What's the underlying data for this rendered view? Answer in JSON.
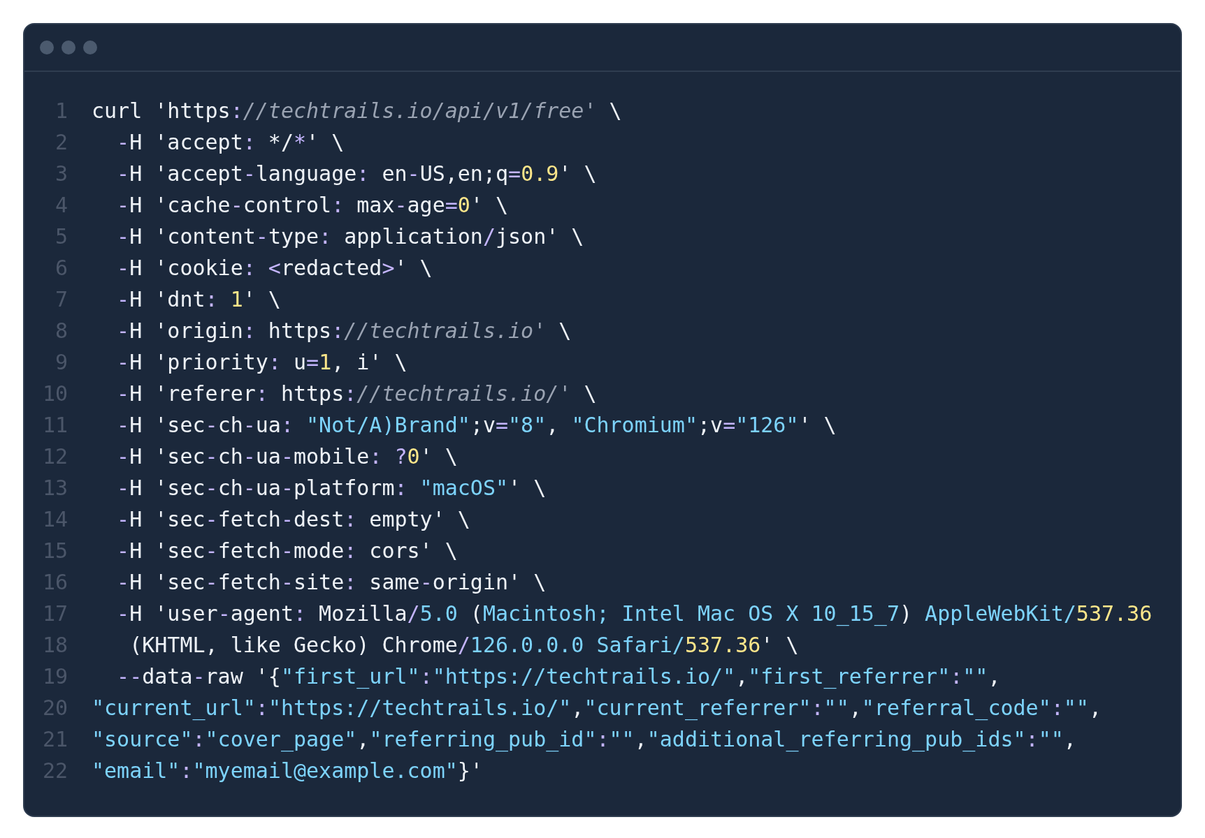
{
  "code_lines": [
    {
      "number": "1",
      "tokens": [
        {
          "text": "curl 'https",
          "kind": "plain"
        },
        {
          "text": ":",
          "kind": "operator"
        },
        {
          "text": "//techtrails.io/api/v1/free'",
          "kind": "comment"
        },
        {
          "text": " \\",
          "kind": "plain"
        }
      ]
    },
    {
      "number": "2",
      "tokens": [
        {
          "text": "  -",
          "kind": "operator"
        },
        {
          "text": "H 'accept",
          "kind": "plain"
        },
        {
          "text": ":",
          "kind": "operator"
        },
        {
          "text": " */",
          "kind": "plain"
        },
        {
          "text": "*",
          "kind": "operator"
        },
        {
          "text": "' \\",
          "kind": "plain"
        }
      ]
    },
    {
      "number": "3",
      "tokens": [
        {
          "text": "  -",
          "kind": "operator"
        },
        {
          "text": "H 'accept",
          "kind": "plain"
        },
        {
          "text": "-",
          "kind": "operator"
        },
        {
          "text": "language",
          "kind": "plain"
        },
        {
          "text": ":",
          "kind": "operator"
        },
        {
          "text": " en",
          "kind": "plain"
        },
        {
          "text": "-",
          "kind": "operator"
        },
        {
          "text": "US,en;q",
          "kind": "plain"
        },
        {
          "text": "=",
          "kind": "operator"
        },
        {
          "text": "0.9",
          "kind": "number"
        },
        {
          "text": "' \\",
          "kind": "plain"
        }
      ]
    },
    {
      "number": "4",
      "tokens": [
        {
          "text": "  -",
          "kind": "operator"
        },
        {
          "text": "H 'cache",
          "kind": "plain"
        },
        {
          "text": "-",
          "kind": "operator"
        },
        {
          "text": "control",
          "kind": "plain"
        },
        {
          "text": ":",
          "kind": "operator"
        },
        {
          "text": " max",
          "kind": "plain"
        },
        {
          "text": "-",
          "kind": "operator"
        },
        {
          "text": "age",
          "kind": "plain"
        },
        {
          "text": "=",
          "kind": "operator"
        },
        {
          "text": "0",
          "kind": "number"
        },
        {
          "text": "' \\",
          "kind": "plain"
        }
      ]
    },
    {
      "number": "5",
      "tokens": [
        {
          "text": "  -",
          "kind": "operator"
        },
        {
          "text": "H 'content",
          "kind": "plain"
        },
        {
          "text": "-",
          "kind": "operator"
        },
        {
          "text": "type",
          "kind": "plain"
        },
        {
          "text": ":",
          "kind": "operator"
        },
        {
          "text": " application",
          "kind": "plain"
        },
        {
          "text": "/",
          "kind": "operator"
        },
        {
          "text": "json' \\",
          "kind": "plain"
        }
      ]
    },
    {
      "number": "6",
      "tokens": [
        {
          "text": "  -",
          "kind": "operator"
        },
        {
          "text": "H 'cookie",
          "kind": "plain"
        },
        {
          "text": ":",
          "kind": "operator"
        },
        {
          "text": " <",
          "kind": "operator"
        },
        {
          "text": "redacted",
          "kind": "plain"
        },
        {
          "text": ">",
          "kind": "operator"
        },
        {
          "text": "' \\",
          "kind": "plain"
        }
      ]
    },
    {
      "number": "7",
      "tokens": [
        {
          "text": "  -",
          "kind": "operator"
        },
        {
          "text": "H 'dnt",
          "kind": "plain"
        },
        {
          "text": ":",
          "kind": "operator"
        },
        {
          "text": " 1",
          "kind": "number"
        },
        {
          "text": "' \\",
          "kind": "plain"
        }
      ]
    },
    {
      "number": "8",
      "tokens": [
        {
          "text": "  -",
          "kind": "operator"
        },
        {
          "text": "H 'origin",
          "kind": "plain"
        },
        {
          "text": ":",
          "kind": "operator"
        },
        {
          "text": " https",
          "kind": "plain"
        },
        {
          "text": ":",
          "kind": "operator"
        },
        {
          "text": "//techtrails.io'",
          "kind": "comment"
        },
        {
          "text": " \\",
          "kind": "plain"
        }
      ]
    },
    {
      "number": "9",
      "tokens": [
        {
          "text": "  -",
          "kind": "operator"
        },
        {
          "text": "H 'priority",
          "kind": "plain"
        },
        {
          "text": ":",
          "kind": "operator"
        },
        {
          "text": " u",
          "kind": "plain"
        },
        {
          "text": "=",
          "kind": "operator"
        },
        {
          "text": "1",
          "kind": "number"
        },
        {
          "text": ", i' \\",
          "kind": "plain"
        }
      ]
    },
    {
      "number": "10",
      "tokens": [
        {
          "text": "  -",
          "kind": "operator"
        },
        {
          "text": "H 'referer",
          "kind": "plain"
        },
        {
          "text": ":",
          "kind": "operator"
        },
        {
          "text": " https",
          "kind": "plain"
        },
        {
          "text": ":",
          "kind": "operator"
        },
        {
          "text": "//techtrails.io/'",
          "kind": "comment"
        },
        {
          "text": " \\",
          "kind": "plain"
        }
      ]
    },
    {
      "number": "11",
      "tokens": [
        {
          "text": "  -",
          "kind": "operator"
        },
        {
          "text": "H 'sec",
          "kind": "plain"
        },
        {
          "text": "-",
          "kind": "operator"
        },
        {
          "text": "ch",
          "kind": "plain"
        },
        {
          "text": "-",
          "kind": "operator"
        },
        {
          "text": "ua",
          "kind": "plain"
        },
        {
          "text": ":",
          "kind": "operator"
        },
        {
          "text": " \"Not/A)Brand\"",
          "kind": "string"
        },
        {
          "text": ";v",
          "kind": "plain"
        },
        {
          "text": "=",
          "kind": "operator"
        },
        {
          "text": "\"8\"",
          "kind": "string"
        },
        {
          "text": ", ",
          "kind": "plain"
        },
        {
          "text": "\"Chromium\"",
          "kind": "string"
        },
        {
          "text": ";v",
          "kind": "plain"
        },
        {
          "text": "=",
          "kind": "operator"
        },
        {
          "text": "\"126\"",
          "kind": "string"
        },
        {
          "text": "' \\",
          "kind": "plain"
        }
      ]
    },
    {
      "number": "12",
      "tokens": [
        {
          "text": "  -",
          "kind": "operator"
        },
        {
          "text": "H 'sec",
          "kind": "plain"
        },
        {
          "text": "-",
          "kind": "operator"
        },
        {
          "text": "ch",
          "kind": "plain"
        },
        {
          "text": "-",
          "kind": "operator"
        },
        {
          "text": "ua",
          "kind": "plain"
        },
        {
          "text": "-",
          "kind": "operator"
        },
        {
          "text": "mobile",
          "kind": "plain"
        },
        {
          "text": ":",
          "kind": "operator"
        },
        {
          "text": " ?",
          "kind": "operator"
        },
        {
          "text": "0",
          "kind": "number"
        },
        {
          "text": "' \\",
          "kind": "plain"
        }
      ]
    },
    {
      "number": "13",
      "tokens": [
        {
          "text": "  -",
          "kind": "operator"
        },
        {
          "text": "H 'sec",
          "kind": "plain"
        },
        {
          "text": "-",
          "kind": "operator"
        },
        {
          "text": "ch",
          "kind": "plain"
        },
        {
          "text": "-",
          "kind": "operator"
        },
        {
          "text": "ua",
          "kind": "plain"
        },
        {
          "text": "-",
          "kind": "operator"
        },
        {
          "text": "platform",
          "kind": "plain"
        },
        {
          "text": ":",
          "kind": "operator"
        },
        {
          "text": " \"macOS\"",
          "kind": "string"
        },
        {
          "text": "' \\",
          "kind": "plain"
        }
      ]
    },
    {
      "number": "14",
      "tokens": [
        {
          "text": "  -",
          "kind": "operator"
        },
        {
          "text": "H 'sec",
          "kind": "plain"
        },
        {
          "text": "-",
          "kind": "operator"
        },
        {
          "text": "fetch",
          "kind": "plain"
        },
        {
          "text": "-",
          "kind": "operator"
        },
        {
          "text": "dest",
          "kind": "plain"
        },
        {
          "text": ":",
          "kind": "operator"
        },
        {
          "text": " empty' \\",
          "kind": "plain"
        }
      ]
    },
    {
      "number": "15",
      "tokens": [
        {
          "text": "  -",
          "kind": "operator"
        },
        {
          "text": "H 'sec",
          "kind": "plain"
        },
        {
          "text": "-",
          "kind": "operator"
        },
        {
          "text": "fetch",
          "kind": "plain"
        },
        {
          "text": "-",
          "kind": "operator"
        },
        {
          "text": "mode",
          "kind": "plain"
        },
        {
          "text": ":",
          "kind": "operator"
        },
        {
          "text": " cors' \\",
          "kind": "plain"
        }
      ]
    },
    {
      "number": "16",
      "tokens": [
        {
          "text": "  -",
          "kind": "operator"
        },
        {
          "text": "H 'sec",
          "kind": "plain"
        },
        {
          "text": "-",
          "kind": "operator"
        },
        {
          "text": "fetch",
          "kind": "plain"
        },
        {
          "text": "-",
          "kind": "operator"
        },
        {
          "text": "site",
          "kind": "plain"
        },
        {
          "text": ":",
          "kind": "operator"
        },
        {
          "text": " same",
          "kind": "plain"
        },
        {
          "text": "-",
          "kind": "operator"
        },
        {
          "text": "origin' \\",
          "kind": "plain"
        }
      ]
    },
    {
      "number": "17",
      "tokens": [
        {
          "text": "  -",
          "kind": "operator"
        },
        {
          "text": "H 'user",
          "kind": "plain"
        },
        {
          "text": "-",
          "kind": "operator"
        },
        {
          "text": "agent",
          "kind": "plain"
        },
        {
          "text": ":",
          "kind": "operator"
        },
        {
          "text": " Mozilla",
          "kind": "plain"
        },
        {
          "text": "/",
          "kind": "operator"
        },
        {
          "text": "5.0",
          "kind": "string"
        },
        {
          "text": " (",
          "kind": "plain"
        },
        {
          "text": "Macintosh; Intel Mac OS X 10_15_7",
          "kind": "string"
        },
        {
          "text": ") ",
          "kind": "plain"
        },
        {
          "text": "AppleWebKit/",
          "kind": "string"
        },
        {
          "text": "537.36",
          "kind": "number"
        }
      ]
    },
    {
      "number": "18",
      "tokens": [
        {
          "text": "   (KHTML, like Gecko) Chrome",
          "kind": "plain"
        },
        {
          "text": "/",
          "kind": "operator"
        },
        {
          "text": "126.0.0.0 Safari/",
          "kind": "string"
        },
        {
          "text": "537.36",
          "kind": "number"
        },
        {
          "text": "' \\",
          "kind": "plain"
        }
      ]
    },
    {
      "number": "19",
      "tokens": [
        {
          "text": "  --",
          "kind": "operator"
        },
        {
          "text": "data",
          "kind": "plain"
        },
        {
          "text": "-",
          "kind": "operator"
        },
        {
          "text": "raw '{",
          "kind": "plain"
        },
        {
          "text": "\"first_url\"",
          "kind": "string"
        },
        {
          "text": ":",
          "kind": "operator"
        },
        {
          "text": "\"https://techtrails.io/\"",
          "kind": "string"
        },
        {
          "text": ",",
          "kind": "plain"
        },
        {
          "text": "\"first_referrer\"",
          "kind": "string"
        },
        {
          "text": ":",
          "kind": "operator"
        },
        {
          "text": "\"\"",
          "kind": "string"
        },
        {
          "text": ",",
          "kind": "plain"
        }
      ]
    },
    {
      "number": "20",
      "tokens": [
        {
          "text": "\"current_url\"",
          "kind": "string"
        },
        {
          "text": ":",
          "kind": "operator"
        },
        {
          "text": "\"https://techtrails.io/\"",
          "kind": "string"
        },
        {
          "text": ",",
          "kind": "plain"
        },
        {
          "text": "\"current_referrer\"",
          "kind": "string"
        },
        {
          "text": ":",
          "kind": "operator"
        },
        {
          "text": "\"\"",
          "kind": "string"
        },
        {
          "text": ",",
          "kind": "plain"
        },
        {
          "text": "\"referral_code\"",
          "kind": "string"
        },
        {
          "text": ":",
          "kind": "operator"
        },
        {
          "text": "\"\"",
          "kind": "string"
        },
        {
          "text": ",",
          "kind": "plain"
        }
      ]
    },
    {
      "number": "21",
      "tokens": [
        {
          "text": "\"source\"",
          "kind": "string"
        },
        {
          "text": ":",
          "kind": "operator"
        },
        {
          "text": "\"cover_page\"",
          "kind": "string"
        },
        {
          "text": ",",
          "kind": "plain"
        },
        {
          "text": "\"referring_pub_id\"",
          "kind": "string"
        },
        {
          "text": ":",
          "kind": "operator"
        },
        {
          "text": "\"\"",
          "kind": "string"
        },
        {
          "text": ",",
          "kind": "plain"
        },
        {
          "text": "\"additional_referring_pub_ids\"",
          "kind": "string"
        },
        {
          "text": ":",
          "kind": "operator"
        },
        {
          "text": "\"\"",
          "kind": "string"
        },
        {
          "text": ",",
          "kind": "plain"
        }
      ]
    },
    {
      "number": "22",
      "tokens": [
        {
          "text": "\"email\"",
          "kind": "string"
        },
        {
          "text": ":",
          "kind": "operator"
        },
        {
          "text": "\"myemail@example.com\"",
          "kind": "string"
        },
        {
          "text": "}'",
          "kind": "plain"
        }
      ]
    }
  ]
}
